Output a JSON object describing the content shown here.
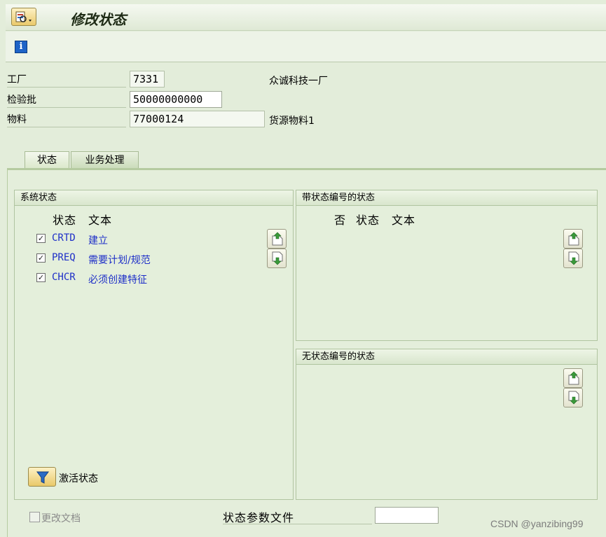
{
  "window": {
    "title": "修改状态"
  },
  "header": {
    "plant_label": "工厂",
    "plant_value": "7331",
    "plant_desc": "众诚科技一厂",
    "lot_label": "检验批",
    "lot_value": "50000000000",
    "material_label": "物料",
    "material_value": "77000124",
    "material_desc": "货源物料1"
  },
  "tabs": [
    {
      "label": "状态",
      "active": true
    },
    {
      "label": "业务处理",
      "active": false
    }
  ],
  "system_status": {
    "title": "系统状态",
    "col_status": "状态",
    "col_text": "文本",
    "rows": [
      {
        "checked": true,
        "code": "CRTD",
        "text": "建立"
      },
      {
        "checked": true,
        "code": "PREQ",
        "text": "需要计划/规范"
      },
      {
        "checked": true,
        "code": "CHCR",
        "text": "必须创建特征"
      }
    ],
    "activate_label": "激活状态"
  },
  "numbered_status": {
    "title": "带状态编号的状态",
    "col_no": "否",
    "col_status": "状态",
    "col_text": "文本"
  },
  "unnumbered_status": {
    "title": "无状态编号的状态"
  },
  "footer": {
    "change_doc_label": "更改文档",
    "status_profile_label": "状态参数文件",
    "status_profile_value": ""
  },
  "watermark": "CSDN @yanzibing99",
  "icons": {
    "menu": "app-menu-icon",
    "info": "info-icon",
    "move_up": "move-up-icon",
    "move_down": "move-down-icon",
    "filter": "filter-icon"
  },
  "colors": {
    "background": "#e3edda",
    "status_text": "#1e2fc8",
    "button_yellow": "#eac96b"
  }
}
